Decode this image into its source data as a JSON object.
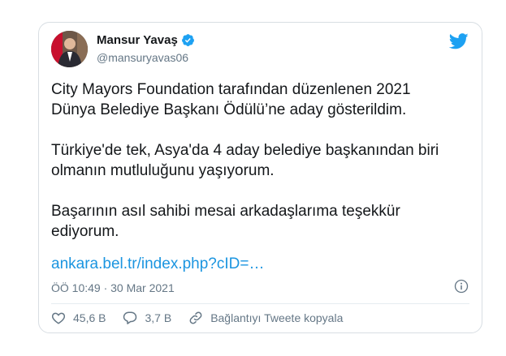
{
  "tweet": {
    "author_name": "Mansur Yavaş",
    "author_handle": "@mansuryavas06",
    "text": "City Mayors Foundation tarafından düzenlenen 2021 Dünya Belediye Başkanı Ödülü’ne aday gösterildim.\n\nTürkiye'de tek, Asya'da 4 aday belediye başkanından biri olmanın mutluluğunu yaşıyorum.\n\nBaşarının asıl sahibi mesai arkadaşlarıma teşekkür ediyorum.",
    "link": "ankara.bel.tr/index.php?cID=…",
    "timestamp": "ÖÖ 10:49 · 30 Mar 2021"
  },
  "actions": {
    "likes": "45,6 B",
    "replies": "3,7 B",
    "copy_link_label": "Bağlantıyı Tweete kopyala"
  },
  "icons": {
    "brand": "twitter-bird-icon",
    "verified": "verified-badge-icon",
    "info": "info-icon",
    "like": "heart-icon",
    "reply": "reply-bubble-icon",
    "copy": "link-icon"
  },
  "colors": {
    "brand": "#1da1f2",
    "link": "#1b95e0",
    "muted": "#657786",
    "text": "#14171a",
    "border": "#d8dee3"
  }
}
